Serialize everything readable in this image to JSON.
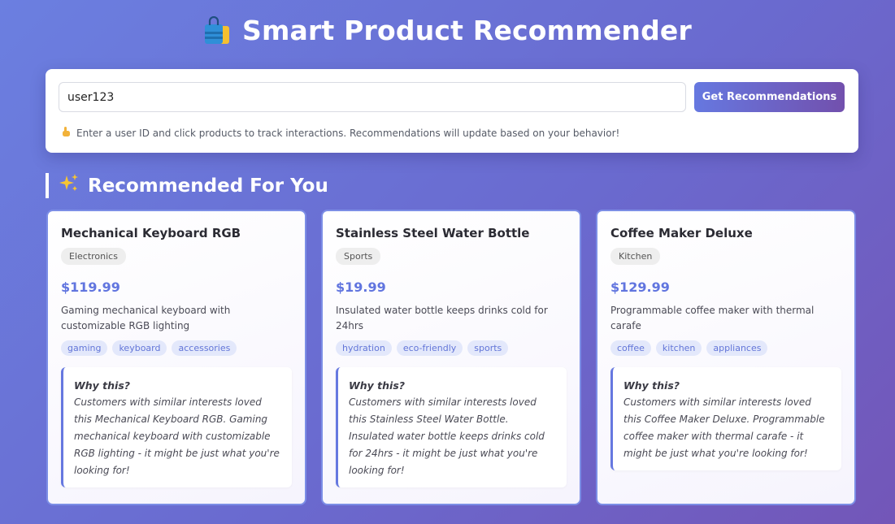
{
  "header": {
    "title": "Smart Product Recommender"
  },
  "search": {
    "user_id_value": "user123",
    "button_label": "Get Recommendations",
    "hint": "Enter a user ID and click products to track interactions. Recommendations will update based on your behavior!"
  },
  "section": {
    "title": "Recommended For You"
  },
  "products": [
    {
      "name": "Mechanical Keyboard RGB",
      "category": "Electronics",
      "price": "$119.99",
      "description": "Gaming mechanical keyboard with customizable RGB lighting",
      "tags": [
        "gaming",
        "keyboard",
        "accessories"
      ],
      "why_title": "Why this?",
      "why_text": "Customers with similar interests loved this Mechanical Keyboard RGB. Gaming mechanical keyboard with customizable RGB lighting - it might be just what you're looking for!"
    },
    {
      "name": "Stainless Steel Water Bottle",
      "category": "Sports",
      "price": "$19.99",
      "description": "Insulated water bottle keeps drinks cold for 24hrs",
      "tags": [
        "hydration",
        "eco-friendly",
        "sports"
      ],
      "why_title": "Why this?",
      "why_text": "Customers with similar interests loved this Stainless Steel Water Bottle. Insulated water bottle keeps drinks cold for 24hrs - it might be just what you're looking for!"
    },
    {
      "name": "Coffee Maker Deluxe",
      "category": "Kitchen",
      "price": "$129.99",
      "description": "Programmable coffee maker with thermal carafe",
      "tags": [
        "coffee",
        "kitchen",
        "appliances"
      ],
      "why_title": "Why this?",
      "why_text": "Customers with similar interests loved this Coffee Maker Deluxe. Programmable coffee maker with thermal carafe - it might be just what you're looking for!"
    }
  ],
  "icons": {
    "title_icon": "shopping-bags-icon",
    "hint_icon": "pointing-hand-icon",
    "section_icon": "sparkles-icon"
  },
  "colors": {
    "accent": "#6678e0",
    "price": "#6175df",
    "card_border": "#7c8ee6"
  }
}
